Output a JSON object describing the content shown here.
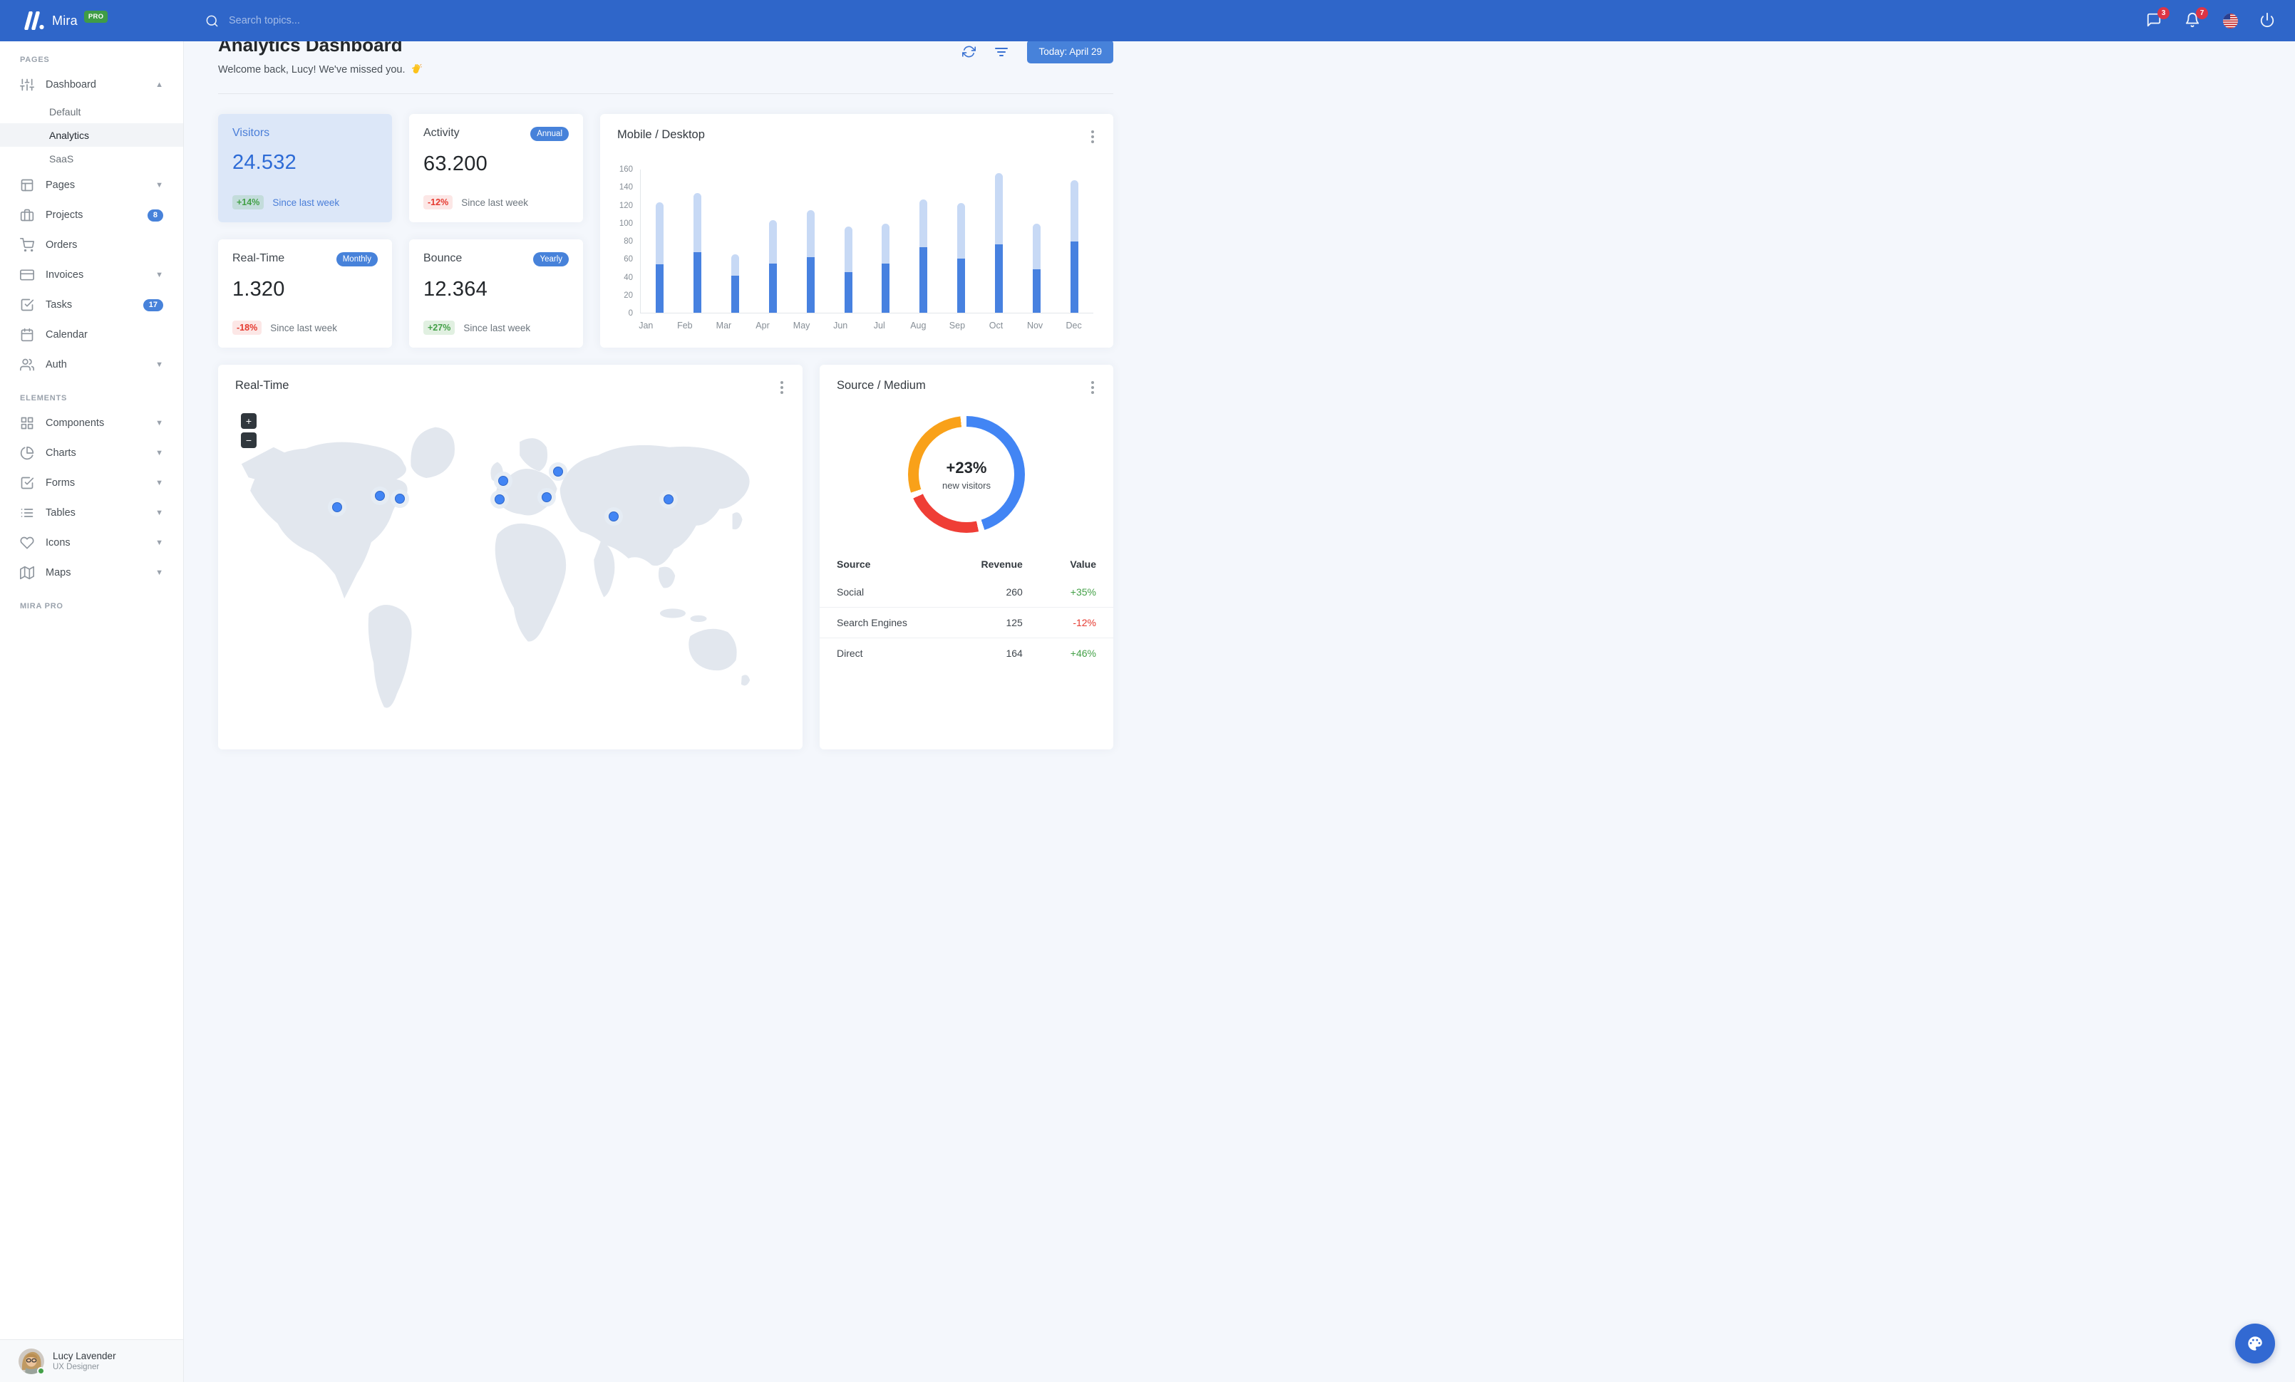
{
  "navbar": {
    "brand": "Mira",
    "brand_badge": "PRO",
    "search_placeholder": "Search topics...",
    "messages_badge": "3",
    "notifications_badge": "7"
  },
  "sidebar": {
    "sections": [
      {
        "label": "PAGES"
      },
      {
        "label": "ELEMENTS"
      },
      {
        "label": "MIRA PRO"
      }
    ],
    "items": {
      "dashboard": "Dashboard",
      "default": "Default",
      "analytics": "Analytics",
      "saas": "SaaS",
      "pages": "Pages",
      "projects": "Projects",
      "projects_badge": "8",
      "orders": "Orders",
      "invoices": "Invoices",
      "tasks": "Tasks",
      "tasks_badge": "17",
      "calendar": "Calendar",
      "auth": "Auth",
      "components": "Components",
      "charts": "Charts",
      "forms": "Forms",
      "tables": "Tables",
      "icons": "Icons",
      "maps": "Maps"
    },
    "user": {
      "name": "Lucy Lavender",
      "role": "UX Designer"
    }
  },
  "header": {
    "title": "Analytics Dashboard",
    "subtitle": "Welcome back, Lucy! We've missed you.",
    "date_button": "Today: April 29"
  },
  "stats": [
    {
      "title": "Visitors",
      "badge": "",
      "value": "24.532",
      "change": "+14%",
      "direction": "up",
      "caption": "Since last week"
    },
    {
      "title": "Activity",
      "badge": "Annual",
      "value": "63.200",
      "change": "-12%",
      "direction": "down",
      "caption": "Since last week"
    },
    {
      "title": "Real-Time",
      "badge": "Monthly",
      "value": "1.320",
      "change": "-18%",
      "direction": "down",
      "caption": "Since last week"
    },
    {
      "title": "Bounce",
      "badge": "Yearly",
      "value": "12.364",
      "change": "+27%",
      "direction": "up",
      "caption": "Since last week"
    }
  ],
  "chart_data": [
    {
      "type": "bar",
      "stacked": true,
      "title": "Mobile / Desktop",
      "categories": [
        "Jan",
        "Feb",
        "Mar",
        "Apr",
        "May",
        "Jun",
        "Jul",
        "Aug",
        "Sep",
        "Oct",
        "Nov",
        "Dec"
      ],
      "series": [
        {
          "name": "Mobile",
          "color": "#4781e0",
          "values": [
            54,
            67,
            41,
            55,
            62,
            45,
            55,
            73,
            60,
            76,
            48,
            79
          ]
        },
        {
          "name": "Desktop",
          "color": "#c7d9f5",
          "values": [
            69,
            66,
            24,
            48,
            52,
            51,
            44,
            53,
            62,
            79,
            51,
            68
          ]
        }
      ],
      "xlabel": "",
      "ylabel": "",
      "ylim": [
        0,
        160
      ],
      "ytick_step": 20,
      "grid": false,
      "legend": "none"
    },
    {
      "type": "pie",
      "donut": true,
      "title": "Source / Medium",
      "labels": [
        "Social",
        "Search Engines",
        "Direct"
      ],
      "values": [
        260,
        125,
        164
      ],
      "colors": [
        "#4285f4",
        "#ef3e36",
        "#f9a119"
      ],
      "center_label": "+23%",
      "center_sublabel": "new visitors",
      "legend": "none"
    }
  ],
  "map_card": {
    "title": "Real-Time",
    "zoom_in": "+",
    "zoom_out": "−",
    "markers": [
      {
        "x": 20.4,
        "y": 32.0
      },
      {
        "x": 27.7,
        "y": 28.5
      },
      {
        "x": 31.1,
        "y": 29.4
      },
      {
        "x": 48.8,
        "y": 24.0
      },
      {
        "x": 48.2,
        "y": 29.6
      },
      {
        "x": 58.2,
        "y": 21.2
      },
      {
        "x": 56.2,
        "y": 29.0
      },
      {
        "x": 67.7,
        "y": 34.6
      },
      {
        "x": 77.1,
        "y": 29.6
      }
    ]
  },
  "source_table": {
    "headers": [
      "Source",
      "Revenue",
      "Value"
    ],
    "rows": [
      {
        "source": "Social",
        "revenue": "260",
        "value": "+35%",
        "direction": "up"
      },
      {
        "source": "Search Engines",
        "revenue": "125",
        "value": "-12%",
        "direction": "down"
      },
      {
        "source": "Direct",
        "revenue": "164",
        "value": "+46%",
        "direction": "up"
      }
    ]
  },
  "colors": {
    "navbar": "#2f66c9",
    "accent": "#4782da",
    "bar_dark": "#4781e0",
    "bar_light": "#c7d9f5",
    "positive": "#43a047",
    "negative": "#e5392f"
  }
}
